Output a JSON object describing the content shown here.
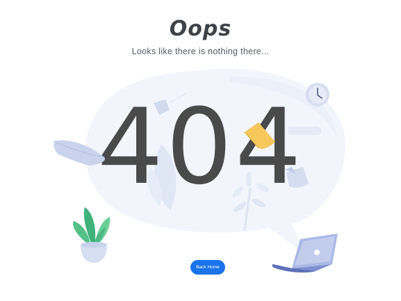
{
  "error": {
    "title": "Oops",
    "message": "Looks like there is nothing there...",
    "code": "404"
  },
  "actions": {
    "back_home_label": "Back Home"
  },
  "colors": {
    "accent": "#1a73e8",
    "text_dark": "#4a4a4a",
    "bubble": "#f2f5fb",
    "paper": "#c3cde8",
    "note": "#f6c75a",
    "leaf": "#5cc58e"
  },
  "icons": [
    "speech-bubble-icon",
    "clock-icon",
    "plant-icon",
    "laptop-icon",
    "paper-icon",
    "sticky-note-icon",
    "leaf-icon"
  ]
}
